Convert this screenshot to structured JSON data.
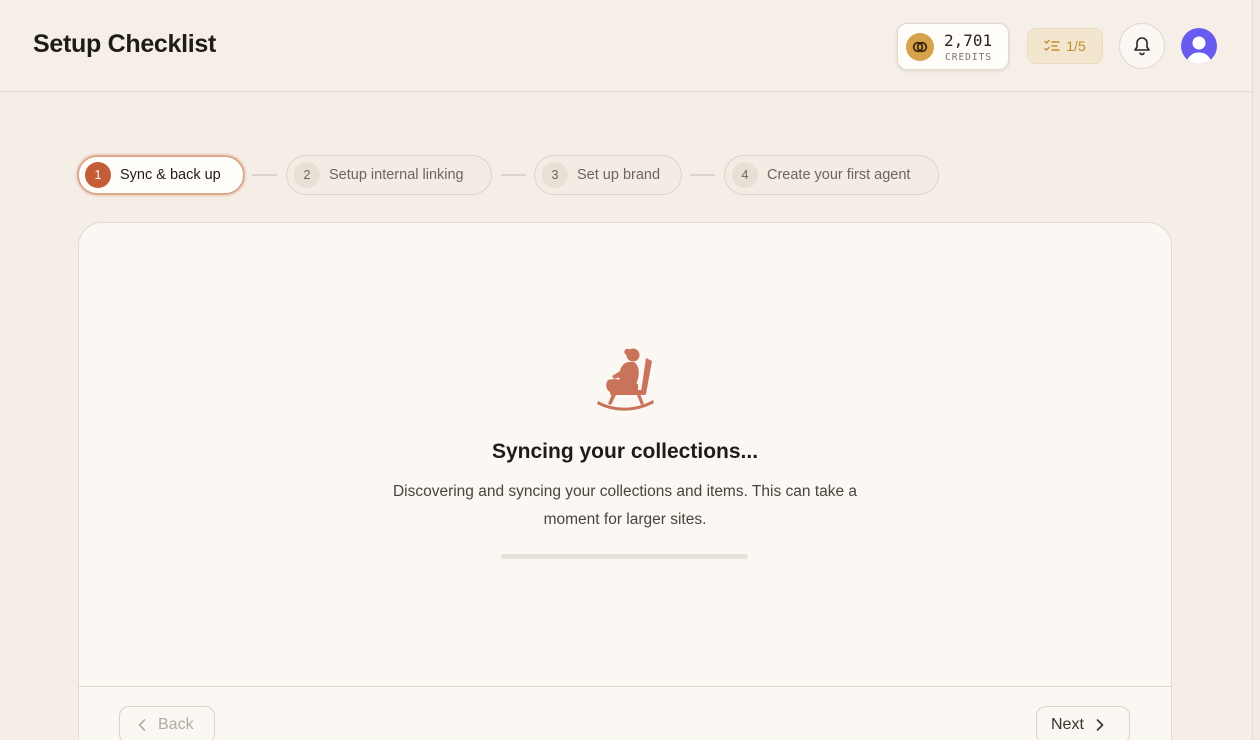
{
  "header": {
    "title": "Setup Checklist",
    "credits": {
      "amount": "2,701",
      "label": "CREDITS",
      "icon": "credits-coin-icon"
    },
    "progress": {
      "text": "1/5",
      "icon": "checklist-icon"
    },
    "notifications_icon": "bell-icon",
    "avatar_icon": "user-avatar"
  },
  "stepper": {
    "steps": [
      {
        "number": "1",
        "label": "Sync & back up",
        "active": true
      },
      {
        "number": "2",
        "label": "Setup internal linking",
        "active": false
      },
      {
        "number": "3",
        "label": "Set up brand",
        "active": false
      },
      {
        "number": "4",
        "label": "Create your first agent",
        "active": false
      }
    ]
  },
  "main": {
    "illustration_icon": "rocking-chair-person-icon",
    "title": "Syncing your collections...",
    "description": "Discovering and syncing your collections and items. This can take a moment for larger sites.",
    "progress_fraction": 0
  },
  "footer": {
    "back_label": "Back",
    "next_label": "Next"
  },
  "colors": {
    "accent": "#c45c38",
    "background": "#f5eee7",
    "card": "#fbf7f2",
    "credits_coin": "#d6a24a",
    "avatar": "#6a5bf0"
  }
}
